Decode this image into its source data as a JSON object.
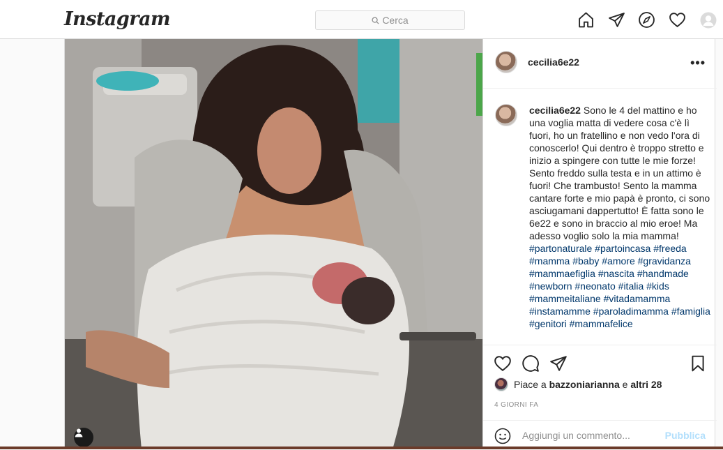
{
  "app": {
    "logo": "Instagram"
  },
  "search": {
    "placeholder": "Cerca"
  },
  "nav": {
    "icons": [
      "home-icon",
      "direct-icon",
      "explore-icon",
      "activity-icon",
      "profile-avatar"
    ]
  },
  "post": {
    "username": "cecilia6e22",
    "caption_text": "Sono le 4 del mattino e ho una voglia matta di vedere cosa c'è lì fuori, ho un fratellino e non vedo l'ora di conoscerlo! Qui dentro è troppo stretto e inizio a spingere con tutte le mie forze! Sento freddo sulla testa e in un attimo è fuori! Che trambusto! Sento la mamma cantare forte e mio papà è pronto, ci sono asciugamani dappertutto! È fatta sono le 6e22 e sono in braccio al mio eroe! Ma adesso voglio solo la mia mamma!",
    "hashtags": "#partonaturale #partoincasa #freeda #mamma #baby #amore #gravidanza #mammaefiglia #nascita #handmade #newborn #neonato #italia #kids #mammeitaliane #vitadamamma #instamamme #paroladimamma #famiglia #genitori #mammafelice",
    "likes_prefix": "Piace a",
    "liked_by": "bazzoniarianna",
    "likes_and": "e",
    "likes_others": "altri 28",
    "time_ago": "4 GIORNI FA",
    "comment_placeholder": "Aggiungi un commento...",
    "publish_label": "Pubblica"
  },
  "colors": {
    "link": "#00376b",
    "publish_disabled": "#b2dffc",
    "border": "#dbdbdb"
  }
}
